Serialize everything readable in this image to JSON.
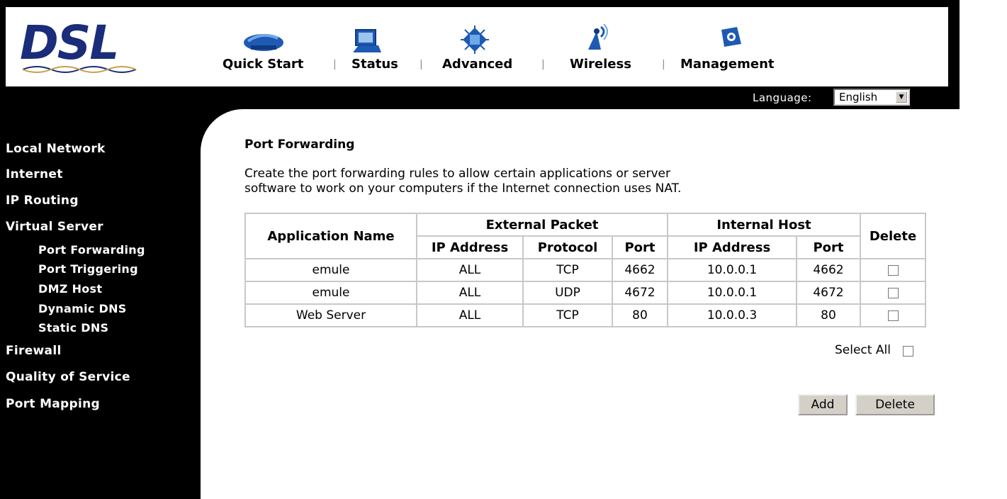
{
  "brand": {
    "logo_text": "DSL"
  },
  "nav": {
    "items": [
      {
        "label": "Quick Start",
        "icon": "quick-start-icon"
      },
      {
        "label": "Status",
        "icon": "status-icon"
      },
      {
        "label": "Advanced",
        "icon": "advanced-icon"
      },
      {
        "label": "Wireless",
        "icon": "wireless-icon"
      },
      {
        "label": "Management",
        "icon": "management-icon"
      }
    ],
    "separator": "|"
  },
  "language": {
    "label": "Language:",
    "value": "English"
  },
  "sidebar": {
    "items": [
      {
        "label": "Local Network"
      },
      {
        "label": "Internet"
      },
      {
        "label": "IP Routing"
      },
      {
        "label": "Virtual Server"
      },
      {
        "label": "Port Forwarding"
      },
      {
        "label": "Port Triggering"
      },
      {
        "label": "DMZ Host"
      },
      {
        "label": "Dynamic DNS"
      },
      {
        "label": "Static DNS"
      },
      {
        "label": "Firewall"
      },
      {
        "label": "Quality of Service"
      },
      {
        "label": "Port Mapping"
      }
    ]
  },
  "main": {
    "title": "Port Forwarding",
    "intro_line1": "Create the port forwarding rules to allow certain applications or server",
    "intro_line2": "software to work on your computers if the Internet connection uses NAT.",
    "table": {
      "header": {
        "app_name": "Application Name",
        "external_packet": "External Packet",
        "internal_host": "Internal Host",
        "delete": "Delete",
        "ext_ip": "IP Address",
        "ext_protocol": "Protocol",
        "ext_port": "Port",
        "int_ip": "IP Address",
        "int_port": "Port"
      },
      "rows": [
        {
          "app": "emule",
          "ext_ip": "ALL",
          "protocol": "TCP",
          "ext_port": "4662",
          "int_ip": "10.0.0.1",
          "int_port": "4662",
          "checked": false
        },
        {
          "app": "emule",
          "ext_ip": "ALL",
          "protocol": "UDP",
          "ext_port": "4672",
          "int_ip": "10.0.0.1",
          "int_port": "4672",
          "checked": false
        },
        {
          "app": "Web Server",
          "ext_ip": "ALL",
          "protocol": "TCP",
          "ext_port": "80",
          "int_ip": "10.0.0.3",
          "int_port": "80",
          "checked": false
        }
      ]
    },
    "select_all_label": "Select All",
    "add_button": "Add",
    "delete_button": "Delete"
  },
  "colors": {
    "logo_blue": "#1a2c7a",
    "frame": "#000000",
    "button_face": "#d4d0c8"
  }
}
